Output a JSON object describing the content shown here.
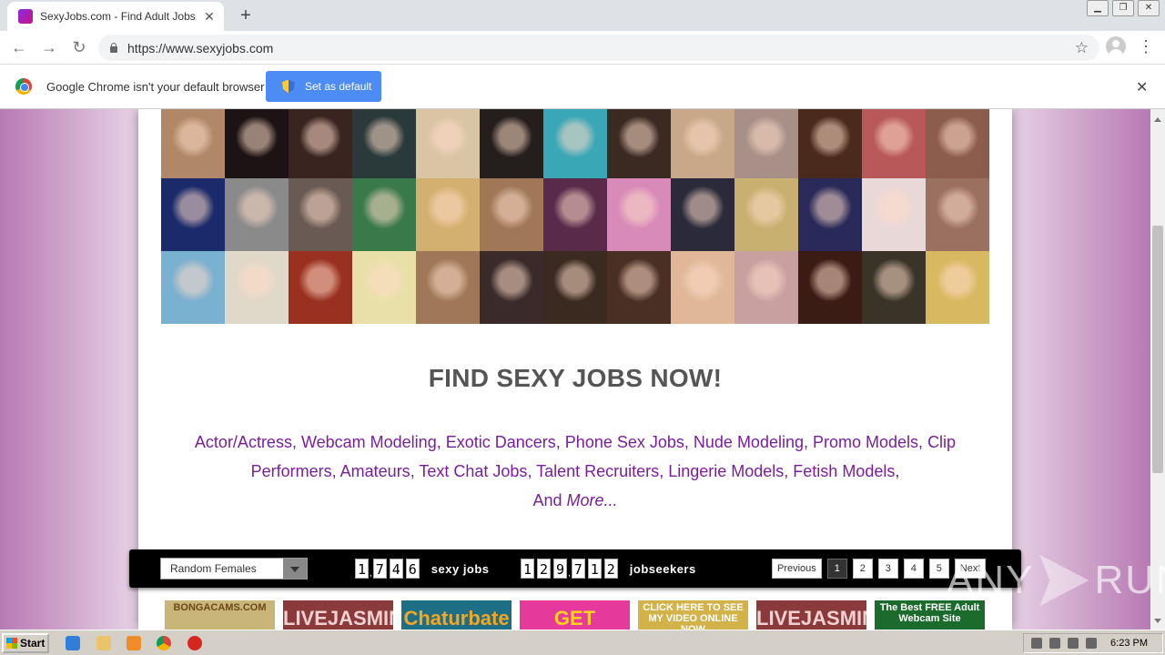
{
  "browser": {
    "tab_title": "SexyJobs.com - Find Adult Jobs, Hir",
    "new_tab_label": "+",
    "url": "https://www.sexyjobs.com",
    "window_controls": [
      "minimize",
      "restore",
      "close"
    ]
  },
  "infobar": {
    "message": "Google Chrome isn't your default browser",
    "button_label": "Set as default"
  },
  "page": {
    "headline": "FIND SEXY JOBS NOW!",
    "categories": [
      "Actor/Actress",
      "Webcam Modeling",
      "Exotic Dancers",
      "Phone Sex Jobs",
      "Nude Modeling",
      "Promo Models",
      "Clip Performers",
      "Amateurs",
      "Text Chat Jobs",
      "Talent Recruiters",
      "Lingerie Models",
      "Fetish Models"
    ],
    "and_label": "And",
    "more_label": "More...",
    "photo_colors": [
      "#b08868",
      "#1c1414",
      "#3a2420",
      "#2a3a3a",
      "#d9c4a4",
      "#241e1c",
      "#3aa7b7",
      "#3a2a22",
      "#c8a888",
      "#a89088",
      "#4a2a1c",
      "#b85858",
      "#8c5c4c",
      "#1a2a6a",
      "#8a8a8a",
      "#6a5a54",
      "#3a7a4a",
      "#d4b070",
      "#a07858",
      "#5a2a4a",
      "#d88ab8",
      "#2a2a3a",
      "#c8b070",
      "#2a2a5a",
      "#e8d8d8",
      "#9a7060",
      "#7ab0d0",
      "#e0d8c8",
      "#9a3020",
      "#e8e0a8",
      "#a07858",
      "#3a2a2a",
      "#3a2a20",
      "#4a3024",
      "#e0b898",
      "#c8a0a0",
      "#3a1c14",
      "#3a3428",
      "#d8b860"
    ],
    "sort_select": "Random Females",
    "jobs_digits": [
      "1",
      "7",
      "4",
      "6"
    ],
    "jobs_label": "sexy jobs",
    "seekers_digits": [
      "1",
      "2",
      "9",
      "7",
      "1",
      "2"
    ],
    "seekers_label": "jobseekers",
    "pagination": {
      "previous": "Previous",
      "pages": [
        "1",
        "2",
        "3",
        "4",
        "5"
      ],
      "next": "Next",
      "active_page": "1"
    },
    "ads": [
      {
        "text": "BONGACAMS.COM",
        "bg": "#c9b47a",
        "fg": "#6a4a10"
      },
      {
        "text": "LIVEJASMIN",
        "bg": "#8a3a3a",
        "fg": "#f0d0d0"
      },
      {
        "text": "Chaturbate",
        "bg": "#1e6e86",
        "fg": "#f5a623"
      },
      {
        "text": "GET",
        "bg": "#e5399b",
        "fg": "#ffd21f"
      },
      {
        "text": "CLICK HERE TO SEE MY VIDEO ONLINE NOW",
        "bg": "#d4b24a",
        "fg": "#fff"
      },
      {
        "text": "LIVEJASMIN",
        "bg": "#8a3a3a",
        "fg": "#f0d0d0"
      },
      {
        "text": "The Best FREE Adult Webcam Site",
        "bg": "#1b6b2c",
        "fg": "#fff"
      }
    ]
  },
  "watermark": {
    "left": "ANY",
    "right": "RUN"
  },
  "taskbar": {
    "start_label": "Start",
    "clock": "6:23 PM"
  }
}
